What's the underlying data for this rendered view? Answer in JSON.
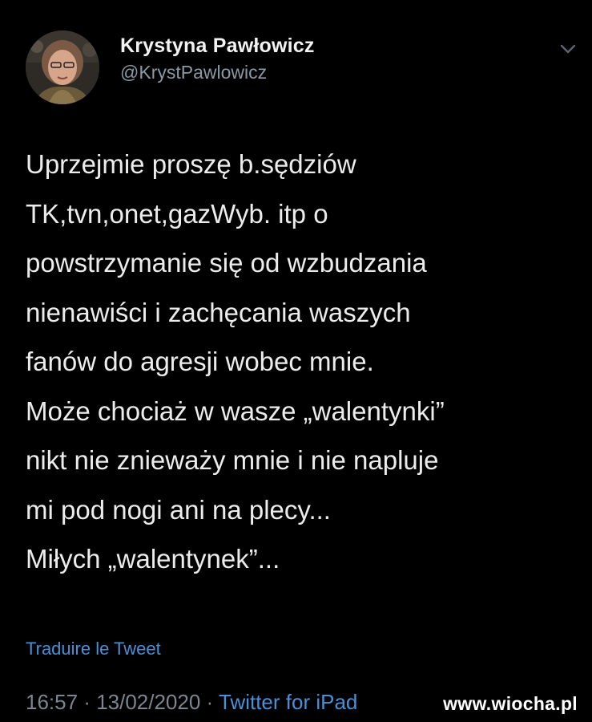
{
  "author": {
    "display_name": "Krystyna Pawłowicz",
    "handle": "@KrystPawlowicz",
    "avatar_icon": "profile-photo"
  },
  "menu_icon": "chevron-down-icon",
  "tweet": {
    "text": "Uprzejmie proszę b.sędziów\nTK,tvn,onet,gazWyb. itp o\npowstrzymanie się od wzbudzania\nnienawiści i zachęcania waszych\nfanów  do agresji wobec mnie.\nMoże chociaż w wasze „walentynki”\nnikt nie znieważy mnie i nie napluje\nmi pod nogi ani na plecy...\nMiłych „walentynek”..."
  },
  "translate_label": "Traduire le Tweet",
  "footer": {
    "time": "16:57",
    "separator1": " · ",
    "date": "13/02/2020",
    "separator2": " · ",
    "source": "Twitter for iPad"
  },
  "watermark": "www.wiocha.pl",
  "colors": {
    "background": "#000000",
    "link": "#4a90d9",
    "muted": "#8b98a5"
  }
}
